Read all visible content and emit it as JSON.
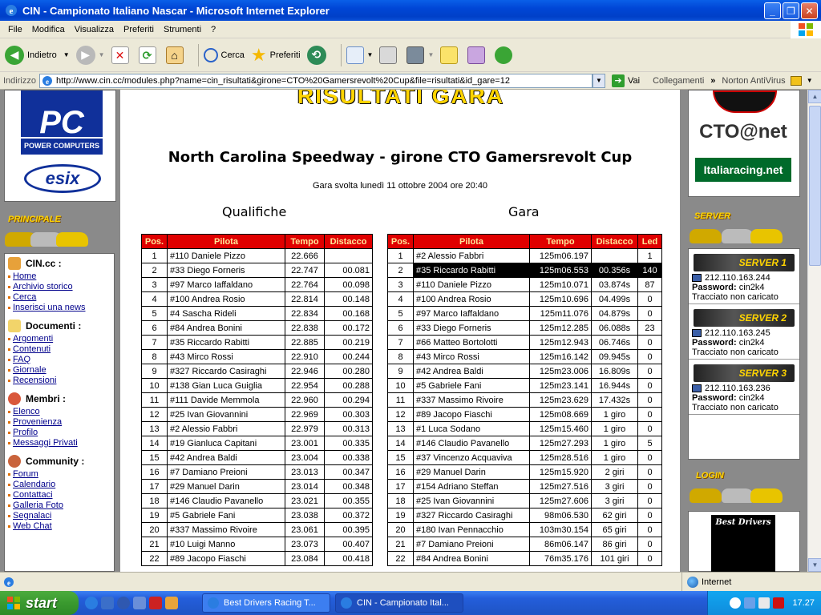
{
  "window": {
    "title": "CIN - Campionato Italiano Nascar - Microsoft Internet Explorer",
    "min": "_",
    "max": "❐",
    "close": "✕"
  },
  "menu": [
    "File",
    "Modifica",
    "Visualizza",
    "Preferiti",
    "Strumenti",
    "?"
  ],
  "toolbar": {
    "back": "Indietro",
    "search": "Cerca",
    "favorites": "Preferiti"
  },
  "address": {
    "label": "Indirizzo",
    "url": "http://www.cin.cc/modules.php?name=cin_risultati&girone=CTO%20Gamersrevolt%20Cup&file=risultati&id_gare=12",
    "go": "Vai",
    "links": "Collegamenti",
    "norton": "Norton AntiVirus"
  },
  "left": {
    "pc_logo": "PC",
    "pc_sub": "POWER COMPUTERS",
    "esix": "esix",
    "banner_principale": "PRINCIPALE",
    "sections": [
      {
        "title": "CIN.cc :",
        "links": [
          "Home",
          "Archivio storico",
          "Cerca",
          "Inserisci una news"
        ]
      },
      {
        "title": "Documenti :",
        "links": [
          "Argomenti",
          "Contenuti",
          "FAQ",
          "Giornale",
          "Recensioni"
        ]
      },
      {
        "title": "Membri :",
        "links": [
          "Elenco",
          "Provenienza",
          "Profilo",
          "Messaggi Privati"
        ]
      },
      {
        "title": "Community :",
        "links": [
          "Forum",
          "Calendario",
          "Contattaci",
          "Galleria Foto",
          "Segnalaci",
          "Web Chat"
        ]
      }
    ]
  },
  "center": {
    "top_banner": "RISULTATI GARA",
    "heading": "North Carolina Speedway - girone CTO Gamersrevolt Cup",
    "subline": "Gara svolta lunedì 11 ottobre 2004 ore 20:40",
    "qual_title": "Qualifiche",
    "race_title": "Gara",
    "qual_headers": [
      "Pos.",
      "Pilota",
      "Tempo",
      "Distacco"
    ],
    "race_headers": [
      "Pos.",
      "Pilota",
      "Tempo",
      "Distacco",
      "Led"
    ],
    "qual_rows": [
      [
        "1",
        "#110 Daniele Pizzo",
        "22.666",
        ""
      ],
      [
        "2",
        "#33 Diego Forneris",
        "22.747",
        "00.081"
      ],
      [
        "3",
        "#97 Marco Iaffaldano",
        "22.764",
        "00.098"
      ],
      [
        "4",
        "#100 Andrea Rosio",
        "22.814",
        "00.148"
      ],
      [
        "5",
        "#4 Sascha Rideli",
        "22.834",
        "00.168"
      ],
      [
        "6",
        "#84 Andrea Bonini",
        "22.838",
        "00.172"
      ],
      [
        "7",
        "#35 Riccardo Rabitti",
        "22.885",
        "00.219"
      ],
      [
        "8",
        "#43 Mirco Rossi",
        "22.910",
        "00.244"
      ],
      [
        "9",
        "#327 Riccardo Casiraghi",
        "22.946",
        "00.280"
      ],
      [
        "10",
        "#138 Gian Luca Guiglia",
        "22.954",
        "00.288"
      ],
      [
        "11",
        "#111 Davide Memmola",
        "22.960",
        "00.294"
      ],
      [
        "12",
        "#25 Ivan Giovannini",
        "22.969",
        "00.303"
      ],
      [
        "13",
        "#2 Alessio Fabbri",
        "22.979",
        "00.313"
      ],
      [
        "14",
        "#19 Gianluca Capitani",
        "23.001",
        "00.335"
      ],
      [
        "15",
        "#42 Andrea Baldi",
        "23.004",
        "00.338"
      ],
      [
        "16",
        "#7 Damiano Preioni",
        "23.013",
        "00.347"
      ],
      [
        "17",
        "#29 Manuel Darin",
        "23.014",
        "00.348"
      ],
      [
        "18",
        "#146 Claudio Pavanello",
        "23.021",
        "00.355"
      ],
      [
        "19",
        "#5 Gabriele Fani",
        "23.038",
        "00.372"
      ],
      [
        "20",
        "#337 Massimo Rivoire",
        "23.061",
        "00.395"
      ],
      [
        "21",
        "#10 Luigi Manno",
        "23.073",
        "00.407"
      ],
      [
        "22",
        "#89 Jacopo Fiaschi",
        "23.084",
        "00.418"
      ]
    ],
    "race_rows": [
      [
        "1",
        "#2 Alessio Fabbri",
        "125m06.197",
        "",
        "1"
      ],
      [
        "2",
        "#35 Riccardo Rabitti",
        "125m06.553",
        "00.356s",
        "140"
      ],
      [
        "3",
        "#110 Daniele Pizzo",
        "125m10.071",
        "03.874s",
        "87"
      ],
      [
        "4",
        "#100 Andrea Rosio",
        "125m10.696",
        "04.499s",
        "0"
      ],
      [
        "5",
        "#97 Marco Iaffaldano",
        "125m11.076",
        "04.879s",
        "0"
      ],
      [
        "6",
        "#33 Diego Forneris",
        "125m12.285",
        "06.088s",
        "23"
      ],
      [
        "7",
        "#66 Matteo Bortolotti",
        "125m12.943",
        "06.746s",
        "0"
      ],
      [
        "8",
        "#43 Mirco Rossi",
        "125m16.142",
        "09.945s",
        "0"
      ],
      [
        "9",
        "#42 Andrea Baldi",
        "125m23.006",
        "16.809s",
        "0"
      ],
      [
        "10",
        "#5 Gabriele Fani",
        "125m23.141",
        "16.944s",
        "0"
      ],
      [
        "11",
        "#337 Massimo Rivoire",
        "125m23.629",
        "17.432s",
        "0"
      ],
      [
        "12",
        "#89 Jacopo Fiaschi",
        "125m08.669",
        "1 giro",
        "0"
      ],
      [
        "13",
        "#1 Luca Sodano",
        "125m15.460",
        "1 giro",
        "0"
      ],
      [
        "14",
        "#146 Claudio Pavanello",
        "125m27.293",
        "1 giro",
        "5"
      ],
      [
        "15",
        "#37 Vincenzo Acquaviva",
        "125m28.516",
        "1 giro",
        "0"
      ],
      [
        "16",
        "#29 Manuel Darin",
        "125m15.920",
        "2 giri",
        "0"
      ],
      [
        "17",
        "#154 Adriano Steffan",
        "125m27.516",
        "3 giri",
        "0"
      ],
      [
        "18",
        "#25 Ivan Giovannini",
        "125m27.606",
        "3 giri",
        "0"
      ],
      [
        "19",
        "#327 Riccardo Casiraghi",
        "98m06.530",
        "62 giri",
        "0"
      ],
      [
        "20",
        "#180 Ivan Pennacchio",
        "103m30.154",
        "65 giri",
        "0"
      ],
      [
        "21",
        "#7 Damiano Preioni",
        "86m06.147",
        "86 giri",
        "0"
      ],
      [
        "22",
        "#84 Andrea Bonini",
        "76m35.176",
        "101 giri",
        "0"
      ]
    ],
    "highlight_row": 1
  },
  "right": {
    "cto": "CTO@net",
    "italiaracing": "Italiaracing.net",
    "banner_server": "SERVER",
    "servers": [
      {
        "head": "SERVER 1",
        "ip": "212.110.163.244",
        "pw_label": "Password:",
        "pw": "cin2k4",
        "status": "Tracciato non caricato"
      },
      {
        "head": "SERVER 2",
        "ip": "212.110.163.245",
        "pw_label": "Password:",
        "pw": "cin2k4",
        "status": "Tracciato non caricato"
      },
      {
        "head": "SERVER 3",
        "ip": "212.110.163.236",
        "pw_label": "Password:",
        "pw": "cin2k4",
        "status": "Tracciato non caricato"
      }
    ],
    "banner_login": "LOGIN",
    "best_drivers": "Best Drivers"
  },
  "statusbar": {
    "zone": "Internet"
  },
  "taskbar": {
    "start": "start",
    "tasks": [
      "Best Drivers Racing T...",
      "CIN - Campionato Ital..."
    ],
    "clock": "17.27"
  }
}
